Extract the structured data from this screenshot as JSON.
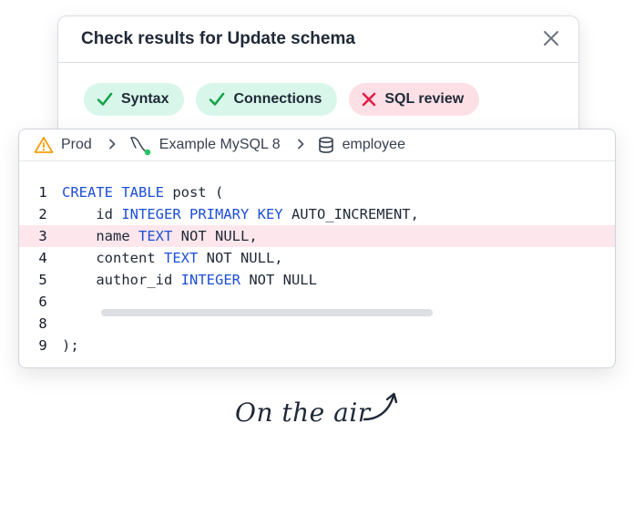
{
  "dialog": {
    "title": "Check results for Update schema",
    "close_icon": "close-icon",
    "checks": [
      {
        "label": "Syntax",
        "status": "pass",
        "icon": "check-icon"
      },
      {
        "label": "Connections",
        "status": "pass",
        "icon": "check-icon"
      },
      {
        "label": "SQL review",
        "status": "fail",
        "icon": "x-icon"
      }
    ]
  },
  "editor": {
    "breadcrumb": {
      "environment": "Prod",
      "instance": "Example MySQL 8",
      "database": "employee"
    },
    "lines": [
      {
        "num": "1",
        "parts": [
          {
            "t": "CREATE TABLE",
            "k": true
          },
          {
            "t": " post ("
          }
        ]
      },
      {
        "num": "2",
        "parts": [
          {
            "t": "    id "
          },
          {
            "t": "INTEGER PRIMARY KEY",
            "k": true
          },
          {
            "t": " AUTO_INCREMENT,"
          }
        ]
      },
      {
        "num": "3",
        "parts": [
          {
            "t": "    name "
          },
          {
            "t": "TEXT",
            "k": true
          },
          {
            "t": " NOT NULL,"
          }
        ],
        "highlight": true
      },
      {
        "num": "4",
        "parts": [
          {
            "t": "    content "
          },
          {
            "t": "TEXT",
            "k": true
          },
          {
            "t": " NOT NULL,"
          }
        ]
      },
      {
        "num": "5",
        "parts": [
          {
            "t": "    author_id "
          },
          {
            "t": "INTEGER",
            "k": true
          },
          {
            "t": " NOT NULL"
          }
        ]
      },
      {
        "num": "6",
        "parts": []
      },
      {
        "num": "8",
        "parts": []
      },
      {
        "num": "9",
        "parts": [
          {
            "t": ");"
          }
        ]
      }
    ]
  },
  "caption": "On the air",
  "colors": {
    "pass_bg": "#d9f6ea",
    "pass_icon": "#16a34a",
    "fail_bg": "#fde0e6",
    "fail_icon": "#e11d48",
    "keyword": "#1d4ed8",
    "highlight": "#fde7ec",
    "warning": "#f59e0b"
  }
}
